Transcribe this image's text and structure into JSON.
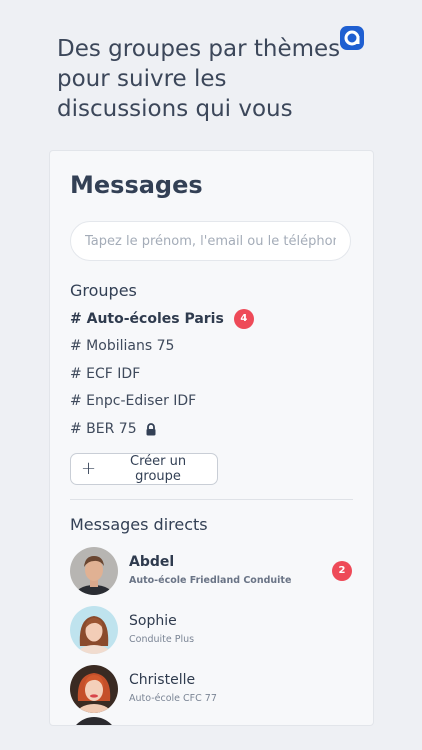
{
  "headline": "Des groupes par thèmes pour suivre les discussions qui vous",
  "colors": {
    "accent": "#1f5fd1",
    "badge": "#ee4a58"
  },
  "messages": {
    "title": "Messages",
    "search_placeholder": "Tapez le prénom, l'email ou le téléphone",
    "groups_title": "Groupes",
    "groups": [
      {
        "label": "# Auto-écoles Paris",
        "badge": "4"
      },
      {
        "label": "# Mobilians 75"
      },
      {
        "label": "# ECF IDF"
      },
      {
        "label": "# Enpc-Ediser IDF"
      },
      {
        "label": "# BER 75",
        "icon": "lock-icon"
      }
    ],
    "create_group_label": "Créer un groupe",
    "direct_title": "Messages directs",
    "direct": [
      {
        "name": "Abdel",
        "subtitle": "Auto-école Friedland Conduite",
        "badge": "2"
      },
      {
        "name": "Sophie",
        "subtitle": "Conduite Plus"
      },
      {
        "name": "Christelle",
        "subtitle": "Auto-école CFC 77"
      }
    ]
  }
}
